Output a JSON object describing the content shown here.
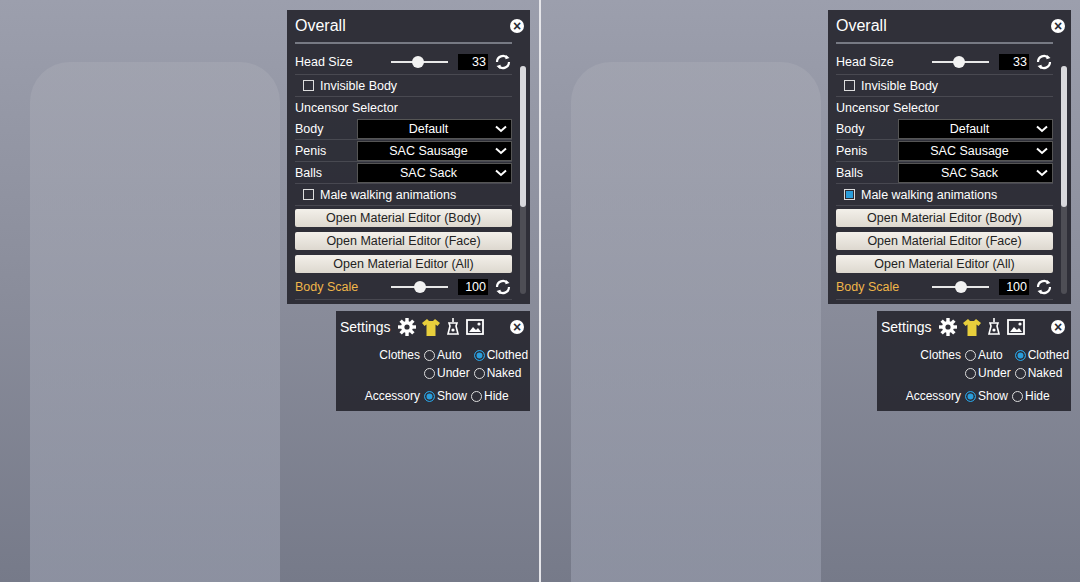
{
  "views": [
    {
      "overall": {
        "title": "Overall",
        "close": "×",
        "rows": [
          {
            "kind": "slider",
            "label": "Head Size",
            "value": "33",
            "level": 0.47,
            "highlighted": false
          },
          {
            "kind": "checkbox",
            "label": "Invisible Body",
            "checked": false
          },
          {
            "kind": "heading",
            "label": "Uncensor Selector"
          },
          {
            "kind": "dropdown",
            "label": "Body",
            "value": "Default"
          },
          {
            "kind": "dropdown",
            "label": "Penis",
            "value": "SAC Sausage"
          },
          {
            "kind": "dropdown",
            "label": "Balls",
            "value": "SAC Sack"
          },
          {
            "kind": "checkbox",
            "label": "Male walking animations",
            "checked": false
          },
          {
            "kind": "button",
            "label": "Open Material Editor (Body)"
          },
          {
            "kind": "button",
            "label": "Open Material Editor (Face)"
          },
          {
            "kind": "button",
            "label": "Open Material Editor (All)"
          },
          {
            "kind": "slider",
            "label": "Body Scale",
            "value": "100",
            "level": 0.5,
            "highlighted": true
          }
        ]
      },
      "settings": {
        "title": "Settings",
        "close": "×",
        "tabs": [
          {
            "selected": false
          },
          {
            "selected": true
          },
          {
            "selected": false
          },
          {
            "selected": false
          }
        ],
        "groups": [
          {
            "label": "Clothes",
            "options": [
              {
                "label": "Auto",
                "selected": false
              },
              {
                "label": "Clothed",
                "selected": true
              },
              {
                "label": "Under",
                "selected": false
              },
              {
                "label": "Naked",
                "selected": false
              }
            ]
          },
          {
            "label": "Accessory",
            "options": [
              {
                "label": "Show",
                "selected": true
              },
              {
                "label": "Hide",
                "selected": false
              }
            ]
          }
        ]
      }
    },
    {
      "overall": {
        "title": "Overall",
        "close": "×",
        "rows": [
          {
            "kind": "slider",
            "label": "Head Size",
            "value": "33",
            "level": 0.47,
            "highlighted": false
          },
          {
            "kind": "checkbox",
            "label": "Invisible Body",
            "checked": false
          },
          {
            "kind": "heading",
            "label": "Uncensor Selector"
          },
          {
            "kind": "dropdown",
            "label": "Body",
            "value": "Default"
          },
          {
            "kind": "dropdown",
            "label": "Penis",
            "value": "SAC Sausage"
          },
          {
            "kind": "dropdown",
            "label": "Balls",
            "value": "SAC Sack"
          },
          {
            "kind": "checkbox",
            "label": "Male walking animations",
            "checked": true
          },
          {
            "kind": "button",
            "label": "Open Material Editor (Body)"
          },
          {
            "kind": "button",
            "label": "Open Material Editor (Face)"
          },
          {
            "kind": "button",
            "label": "Open Material Editor (All)"
          },
          {
            "kind": "slider",
            "label": "Body Scale",
            "value": "100",
            "level": 0.5,
            "highlighted": true
          }
        ]
      },
      "settings": {
        "title": "Settings",
        "close": "×",
        "tabs": [
          {
            "selected": false
          },
          {
            "selected": true
          },
          {
            "selected": false
          },
          {
            "selected": false
          }
        ],
        "groups": [
          {
            "label": "Clothes",
            "options": [
              {
                "label": "Auto",
                "selected": false
              },
              {
                "label": "Clothed",
                "selected": true
              },
              {
                "label": "Under",
                "selected": false
              },
              {
                "label": "Naked",
                "selected": false
              }
            ]
          },
          {
            "label": "Accessory",
            "options": [
              {
                "label": "Show",
                "selected": true
              },
              {
                "label": "Hide",
                "selected": false
              }
            ]
          }
        ]
      }
    }
  ]
}
